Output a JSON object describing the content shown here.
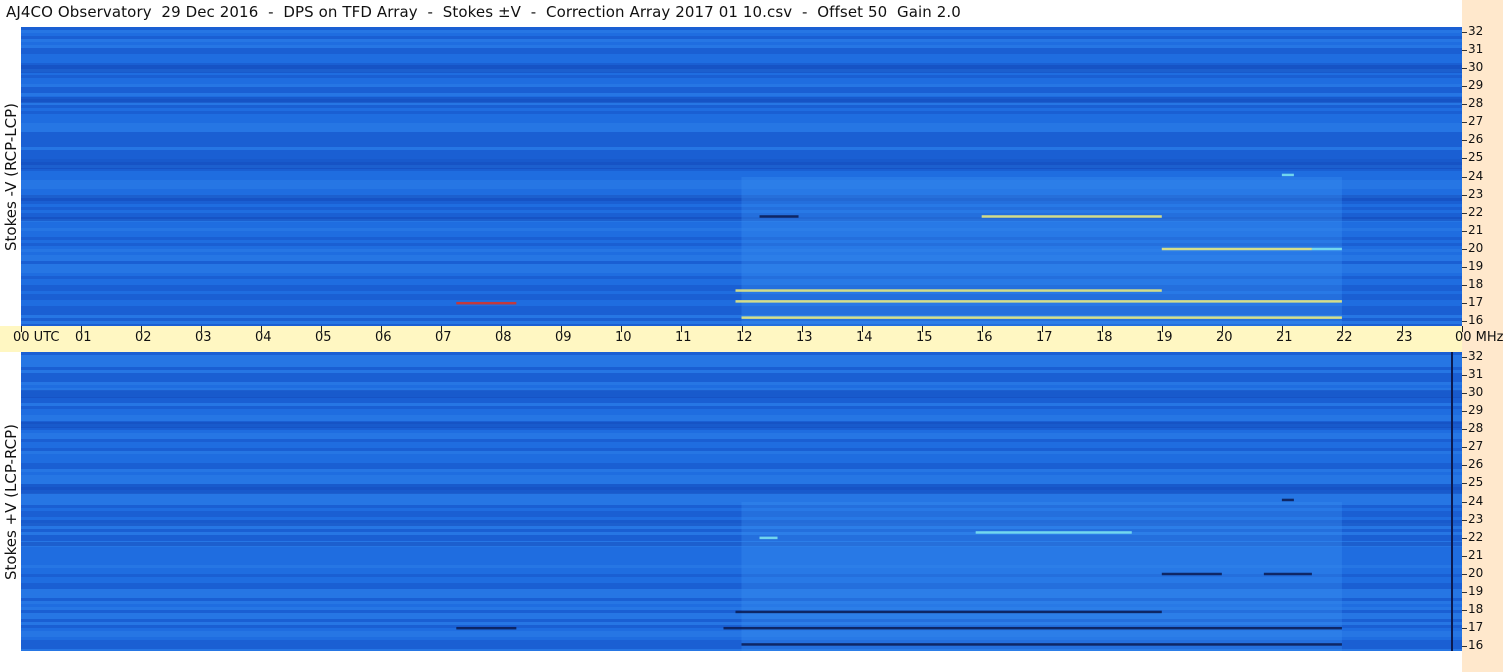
{
  "window": {
    "title": "AJ4CO Observatory  29 Dec 2016  -  DPS on TFD Array  -  Stokes ±V  -  Correction Array 2017 01 10.csv  -  Offset 50  Gain 2.0"
  },
  "panels": {
    "top_label": "Stokes -V (RCP-LCP)",
    "bottom_label": "Stokes +V (LCP-RCP)"
  },
  "time_axis": {
    "hours": [
      "00 UTC",
      "01",
      "02",
      "03",
      "04",
      "05",
      "06",
      "07",
      "08",
      "09",
      "10",
      "11",
      "12",
      "13",
      "14",
      "15",
      "16",
      "17",
      "18",
      "19",
      "20",
      "21",
      "22",
      "23",
      "00 MHz"
    ]
  },
  "freq_axis": {
    "unit": "MHz",
    "ticks": [
      "32",
      "31",
      "30",
      "29",
      "28",
      "27",
      "26",
      "25",
      "24",
      "23",
      "22",
      "21",
      "20",
      "19",
      "18",
      "17",
      "16"
    ]
  },
  "chart_data": [
    {
      "type": "heatmap",
      "title": "Stokes -V (RCP-LCP)",
      "x_axis": {
        "label": "UTC",
        "range_hours": [
          0,
          24
        ]
      },
      "y_axis": {
        "label": "MHz",
        "range": [
          16,
          32
        ]
      },
      "colors": {
        "background": "#1f6ee0",
        "band_dark": "#1554c8",
        "band_light": "#2b7ee8",
        "burst_yellow": "#f2f07a",
        "burst_cyan": "#7fe8f0",
        "burst_dark": "#0b1a50",
        "burst_red": "#e03020"
      },
      "features": [
        {
          "kind": "burst",
          "start_utc": 7.25,
          "end_utc": 8.25,
          "freq_mhz": 17.0,
          "color": "red"
        },
        {
          "kind": "burst",
          "start_utc": 11.9,
          "end_utc": 22.0,
          "freq_mhz": 17.1,
          "color": "yellow"
        },
        {
          "kind": "burst",
          "start_utc": 11.9,
          "end_utc": 19.0,
          "freq_mhz": 17.7,
          "color": "yellow"
        },
        {
          "kind": "burst",
          "start_utc": 12.0,
          "end_utc": 22.0,
          "freq_mhz": 16.2,
          "color": "yellow"
        },
        {
          "kind": "burst",
          "start_utc": 12.3,
          "end_utc": 12.95,
          "freq_mhz": 21.8,
          "color": "dark"
        },
        {
          "kind": "burst",
          "start_utc": 16.0,
          "end_utc": 19.0,
          "freq_mhz": 21.8,
          "color": "yellow"
        },
        {
          "kind": "burst",
          "start_utc": 19.0,
          "end_utc": 21.5,
          "freq_mhz": 20.0,
          "color": "yellow"
        },
        {
          "kind": "burst",
          "start_utc": 21.5,
          "end_utc": 22.0,
          "freq_mhz": 20.0,
          "color": "cyan"
        },
        {
          "kind": "burst",
          "start_utc": 21.0,
          "end_utc": 21.2,
          "freq_mhz": 24.1,
          "color": "cyan"
        }
      ]
    },
    {
      "type": "heatmap",
      "title": "Stokes +V (LCP-RCP)",
      "x_axis": {
        "label": "UTC",
        "range_hours": [
          0,
          24
        ]
      },
      "y_axis": {
        "label": "MHz",
        "range": [
          16,
          32
        ]
      },
      "colors": {
        "background": "#1f6ee0",
        "band_dark": "#1554c8",
        "band_light": "#2b7ee8",
        "burst_yellow": "#f2f07a",
        "burst_cyan": "#7fe8f0",
        "burst_dark": "#0b1a50",
        "burst_red": "#e03020"
      },
      "features": [
        {
          "kind": "burst",
          "start_utc": 7.25,
          "end_utc": 8.25,
          "freq_mhz": 17.0,
          "color": "dark"
        },
        {
          "kind": "burst",
          "start_utc": 11.7,
          "end_utc": 22.0,
          "freq_mhz": 17.0,
          "color": "dark"
        },
        {
          "kind": "burst",
          "start_utc": 11.9,
          "end_utc": 19.0,
          "freq_mhz": 17.9,
          "color": "dark"
        },
        {
          "kind": "burst",
          "start_utc": 12.0,
          "end_utc": 22.0,
          "freq_mhz": 16.1,
          "color": "dark"
        },
        {
          "kind": "burst",
          "start_utc": 12.3,
          "end_utc": 12.6,
          "freq_mhz": 22.0,
          "color": "cyan"
        },
        {
          "kind": "burst",
          "start_utc": 15.9,
          "end_utc": 18.5,
          "freq_mhz": 22.3,
          "color": "cyan"
        },
        {
          "kind": "burst",
          "start_utc": 19.0,
          "end_utc": 20.0,
          "freq_mhz": 20.0,
          "color": "dark"
        },
        {
          "kind": "burst",
          "start_utc": 20.7,
          "end_utc": 21.5,
          "freq_mhz": 20.0,
          "color": "dark"
        },
        {
          "kind": "burst",
          "start_utc": 21.0,
          "end_utc": 21.2,
          "freq_mhz": 24.1,
          "color": "dark"
        }
      ]
    }
  ]
}
